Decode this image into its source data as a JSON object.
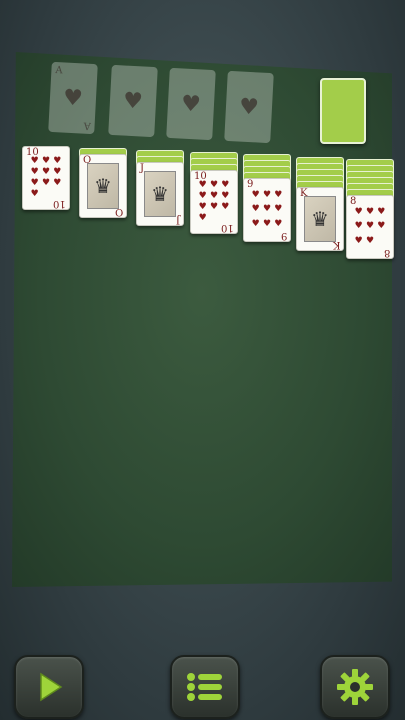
{
  "foundations": [
    {
      "suit": "heart",
      "glyph": "♥"
    },
    {
      "suit": "heart",
      "glyph": "♥"
    },
    {
      "suit": "heart",
      "glyph": "♥"
    },
    {
      "suit": "heart",
      "glyph": "♥"
    }
  ],
  "tableau": [
    {
      "rank": "10",
      "hidden": 0
    },
    {
      "rank": "Q",
      "hidden": 1
    },
    {
      "rank": "J",
      "hidden": 2
    },
    {
      "rank": "10",
      "hidden": 3
    },
    {
      "rank": "9",
      "hidden": 4
    },
    {
      "rank": "K",
      "hidden": 5
    },
    {
      "rank": "8",
      "hidden": 6
    }
  ],
  "colors": {
    "card_back": "#a3cd4a",
    "felt": "#2e4a33",
    "heart": "#8b1a1a",
    "button_icon": "#9ed43a"
  },
  "toolbar": {
    "play_icon": "play-icon",
    "menu_icon": "menu-list-icon",
    "settings_icon": "gear-icon"
  }
}
